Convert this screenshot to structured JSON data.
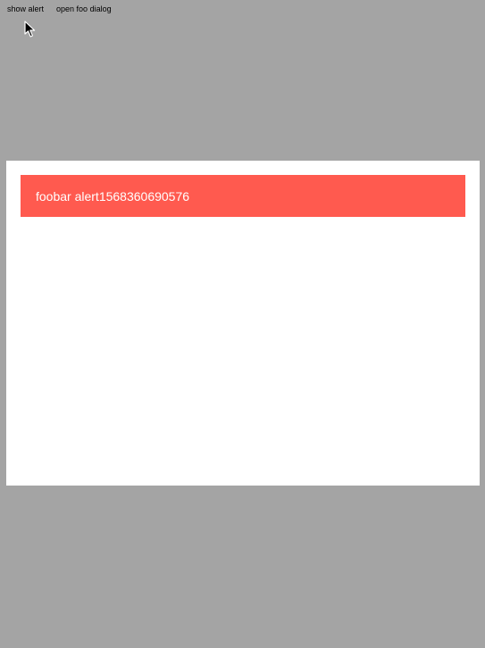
{
  "toolbar": {
    "show_alert_label": "show alert",
    "open_dialog_label": "open foo dialog"
  },
  "dialog": {
    "alert_text": "foobar alert1568360690576"
  },
  "colors": {
    "page_background": "#a4a4a4",
    "dialog_background": "#ffffff",
    "alert_background": "#ff5a4f",
    "alert_text": "#ffffff"
  },
  "icons": {
    "cursor": "mouse-pointer-icon"
  }
}
